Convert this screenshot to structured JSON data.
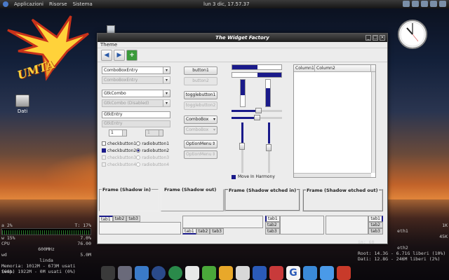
{
  "top_panel": {
    "menus": [
      "Applicazioni",
      "Risorse",
      "Sistema"
    ],
    "clock": "lun 3 dic, 17.57.37"
  },
  "desktop": {
    "logo_text": "UMTA",
    "drive_label": "Dati"
  },
  "window": {
    "title": "The Widget Factory",
    "menu": [
      "Theme"
    ],
    "toolbar": {
      "back_icon": "arrow-left-icon",
      "forward_icon": "arrow-right-icon",
      "add_icon": "plus-icon"
    },
    "left_column": {
      "combo_entry": "ComboBoxEntry",
      "combo_entry_disabled": "ComboBoxEntry",
      "gtk_combo": "GtkCombo",
      "gtk_combo_disabled": "GtkCombo (Disabled)",
      "gtk_entry": "GtkEntry",
      "gtk_entry_disabled": "GtkEntry",
      "spin_value": "1",
      "spin_disabled_value": "1",
      "checks": [
        {
          "check": "checkbutton1",
          "radio": "radiobutton1"
        },
        {
          "check": "checkbutton2",
          "radio": "radiobutton2"
        },
        {
          "check": "checkbutton3",
          "radio": "radiobutton3"
        },
        {
          "check": "checkbutton4",
          "radio": "radiobutton4"
        }
      ]
    },
    "mid_column": {
      "button1": "button1",
      "button2": "button2",
      "toggle1": "togglebutton1",
      "toggle2": "togglebutton2",
      "combobox": "ComboBox",
      "combobox_disabled": "ComboBox",
      "optionmenu": "OptionMenu",
      "optionmenu_disabled": "OptionMenu"
    },
    "progress": {
      "top_hbar_fraction": 0.5,
      "top_hbar2_fraction": 0.45,
      "vbar_left_fraction": 0.55,
      "vbar_right_fraction": 0.65
    },
    "move_in_harmony": "Move In Harmony",
    "tree": {
      "columns": [
        "Column1",
        "Column2"
      ]
    },
    "frames": [
      "Frame (Shadow in)",
      "Frame (Shadow out)",
      "Frame (Shadow etched in)",
      "Frame (Shadow etched out)"
    ],
    "tabs": [
      "tab1",
      "tab2",
      "tab3"
    ]
  },
  "conky_left": {
    "lines": [
      {
        "l": "a 2%",
        "r": "T: 17%"
      },
      {
        "l": "w 15%",
        "r": "7.0%"
      },
      {
        "l": "CPU",
        "r": "76.00"
      },
      {
        "l": "",
        "r": "600MHz"
      },
      {
        "l": "wd",
        "r": "5.0M"
      },
      {
        "l": "",
        "r": "48.0K"
      }
    ],
    "hostname": "linda",
    "memory": "Memoria: 1012M - 673M usati (66%)",
    "swap": "Swap: 1922M - 0M usati (0%)"
  },
  "conky_right": {
    "lines": [
      {
        "l": "",
        "r": "1K"
      },
      {
        "l": "",
        "r": "eth1"
      },
      {
        "l": "",
        "r": "45K"
      }
    ],
    "in_label": "in: 60",
    "iface": "eth2",
    "root": "Root: 14.3G - 6.71G liberi (10%)",
    "dati": "Dati: 12.8G - 246M liberi (2%)"
  },
  "dock_icons": [
    "launcher-icon",
    "tools-icon",
    "pictures-icon",
    "globe-icon",
    "earth-icon",
    "mail-icon",
    "people-icon",
    "editor-icon",
    "notes-icon",
    "presentation-icon",
    "package-icon",
    "google-icon",
    "window-icon",
    "calendar-icon",
    "monitor-icon"
  ],
  "colors": {
    "accent": "#1a1a8a",
    "logo_yellow": "#ffd23a",
    "logo_red": "#c8321a"
  }
}
